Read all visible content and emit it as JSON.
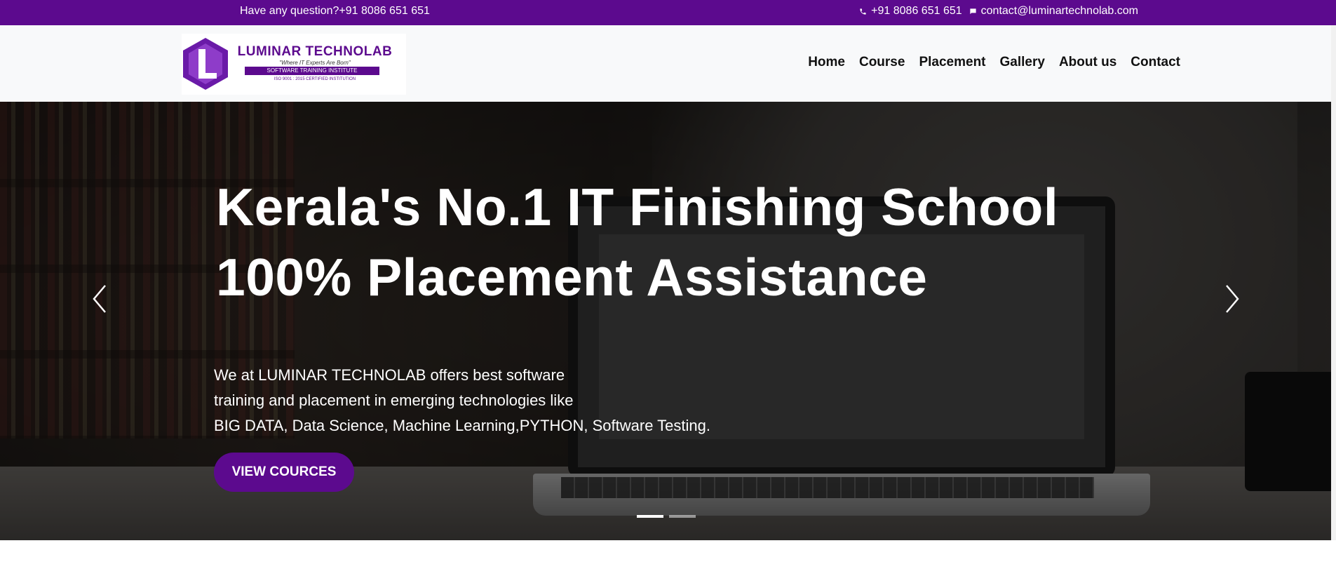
{
  "topbar": {
    "question": "Have any question?+91 8086 651 651",
    "phone": "+91 8086 651 651",
    "email": "contact@luminartechnolab.com",
    "icons": [
      "phone-icon",
      "chat-icon"
    ]
  },
  "logo": {
    "brand": "LUMINAR TECHNOLAB",
    "tagline": "\"Where IT Experts Are Born\"",
    "subtitle": "SOFTWARE TRAINING INSTITUTE",
    "iso": "ISO 9001 : 2015 CERTIFIED INSTITUTION"
  },
  "nav": {
    "items": [
      {
        "label": "Home"
      },
      {
        "label": "Course"
      },
      {
        "label": "Placement"
      },
      {
        "label": "Gallery"
      },
      {
        "label": "About us"
      },
      {
        "label": "Contact"
      }
    ]
  },
  "hero": {
    "headline_line1": "Kerala's No.1 IT Finishing School",
    "headline_line2": "100% Placement Assistance",
    "desc_line1": "We at LUMINAR TECHNOLAB offers best software",
    "desc_line2": "training and placement in emerging technologies like",
    "desc_line3": "BIG DATA, Data Science, Machine Learning,PYTHON, Software Testing.",
    "cta_label": "VIEW COURCES",
    "slides_total": 2,
    "active_slide": 1
  },
  "colors": {
    "brand_purple": "#5c0a8e",
    "header_bg": "#f8f9fa",
    "nav_text": "#111111"
  }
}
